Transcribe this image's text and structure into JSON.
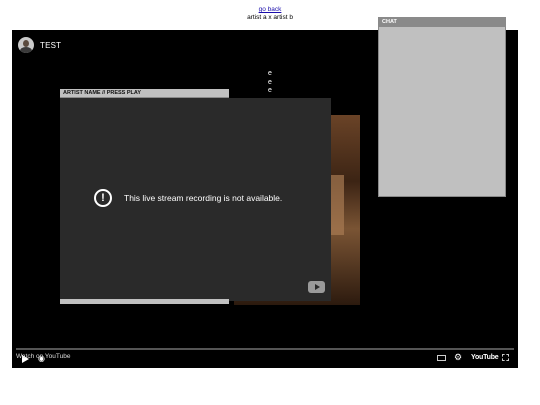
{
  "header": {
    "back_link": "go back",
    "subtitle": "artist a x artist b"
  },
  "player": {
    "channel_title": "TEST",
    "side_letters": [
      "e",
      "e",
      "e"
    ],
    "message": "This live stream recording is not available.",
    "watch_label": "Watch on YouTube",
    "brand": "YouTube"
  },
  "windows": {
    "video_title": "ARTIST NAME // PRESS PLAY",
    "chat_title": "CHAT"
  },
  "icons": {
    "avatar": "avatar-icon",
    "alert": "alert-circle-icon",
    "youtube": "youtube-logo-icon",
    "play": "play-icon",
    "volume": "volume-icon",
    "captions": "captions-icon",
    "settings": "gear-icon",
    "fullscreen": "fullscreen-icon"
  },
  "colors": {
    "window_chrome": "#c0c0c0",
    "player_bg": "#000000",
    "video_bg": "#2a2a2a",
    "link": "#1a0dab"
  }
}
